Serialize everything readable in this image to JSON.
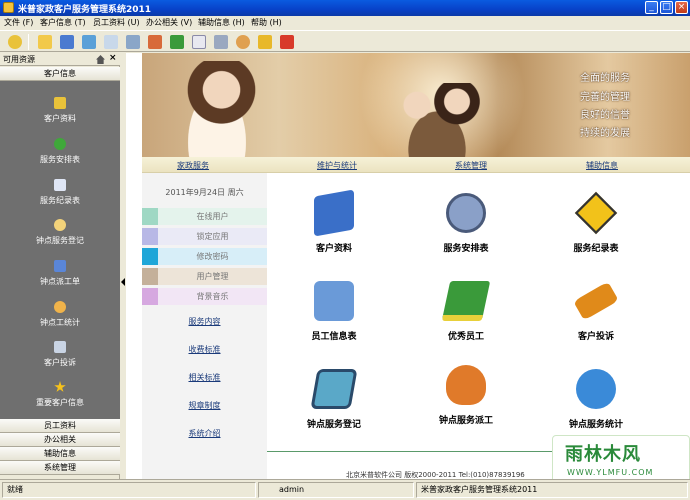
{
  "window": {
    "title": "米普家政客户服务管理系统2011",
    "controls": {
      "minimize": "_",
      "maximize": "□",
      "close": "×"
    }
  },
  "menu": [
    "文件 (F)",
    "客户信息 (T)",
    "员工资料 (U)",
    "办公相关 (V)",
    "辅助信息 (H)",
    "帮助 (H)"
  ],
  "toolbar_icons": [
    "refresh-icon",
    "folder-icon",
    "grid-icon",
    "chart-icon",
    "edit-icon",
    "list-icon",
    "home-icon",
    "recycle-icon",
    "mail-icon",
    "printer-icon",
    "user-icon",
    "key-icon",
    "exit-icon"
  ],
  "left_panel": {
    "title": "可用资源",
    "close": "×",
    "top_section": "客户信息",
    "items": [
      {
        "label": "客户资料",
        "icon": "folder-icon",
        "color": "#e9c23a"
      },
      {
        "label": "服务安排表",
        "icon": "arrow-right-icon",
        "color": "#3fa83a"
      },
      {
        "label": "服务纪录表",
        "icon": "document-icon",
        "color": "#dfe6f5"
      },
      {
        "label": "钟点服务登记",
        "icon": "search-icon",
        "color": "#f2d27a"
      },
      {
        "label": "钟点派工单",
        "icon": "calendar-icon",
        "color": "#5a86d8"
      },
      {
        "label": "钟点工统计",
        "icon": "hand-icon",
        "color": "#f0b34a"
      },
      {
        "label": "客户投诉",
        "icon": "mailbox-icon",
        "color": "#c9d4e4"
      },
      {
        "label": "重要客户信息",
        "icon": "star-icon",
        "color": "#f6c21c"
      }
    ],
    "scroll_arrow": "▼",
    "bottom_sections": [
      "员工资料",
      "办公相关",
      "辅助信息",
      "系统管理"
    ]
  },
  "banner": {
    "slogans": [
      "全面的服务",
      "完善的管理",
      "良好的信誉",
      "持续的发展"
    ]
  },
  "navstrip": [
    "家政服务",
    "维护与统计",
    "系统管理",
    "辅助信息"
  ],
  "sidebar": {
    "date": "2011年9月24日  周六",
    "quick_actions": [
      {
        "label": "在线用户",
        "color": "#9fd8c4",
        "bg": "#e4f3ec"
      },
      {
        "label": "锁定应用",
        "color": "#b8b8e6",
        "bg": "#eaeaf6"
      },
      {
        "label": "修改密码",
        "color": "#1fa6d8",
        "bg": "#d7eef8"
      },
      {
        "label": "用户管理",
        "color": "#c4b09a",
        "bg": "#ede4d8"
      },
      {
        "label": "背景音乐",
        "color": "#d6a8e0",
        "bg": "#f2e6f5"
      }
    ],
    "links": [
      "服务内容",
      "收费标准",
      "相关标准",
      "规章制度",
      "系统介绍"
    ]
  },
  "tiles": [
    {
      "label": "客户资料",
      "icon": "customer-file-icon",
      "color": "#3a6fc8"
    },
    {
      "label": "服务安排表",
      "icon": "clock-icon",
      "color": "#8aa0c8"
    },
    {
      "label": "服务纪录表",
      "icon": "pedestrian-sign-icon",
      "color": "#f2c21a"
    },
    {
      "label": "员工信息表",
      "icon": "printer-icon",
      "color": "#6a9ad8"
    },
    {
      "label": "优秀员工",
      "icon": "book-icon",
      "color": "#3a9a3a"
    },
    {
      "label": "客户投诉",
      "icon": "gavel-icon",
      "color": "#e08a1a"
    },
    {
      "label": "钟点服务登记",
      "icon": "checklist-icon",
      "color": "#5aa8c8"
    },
    {
      "label": "钟点服务派工",
      "icon": "headset-icon",
      "color": "#e07a2a"
    },
    {
      "label": "钟点服务统计",
      "icon": "globe-search-icon",
      "color": "#3a8ad8"
    }
  ],
  "footer": "北京米普软件公司  版权2000-2011  Tel:(010)87839196",
  "watermark": {
    "main": "雨林木风",
    "url": "WWW.YLMFU.COM"
  },
  "status": {
    "ready": "就绪",
    "user": "admin",
    "system": "米普家政客户服务管理系统2011"
  }
}
